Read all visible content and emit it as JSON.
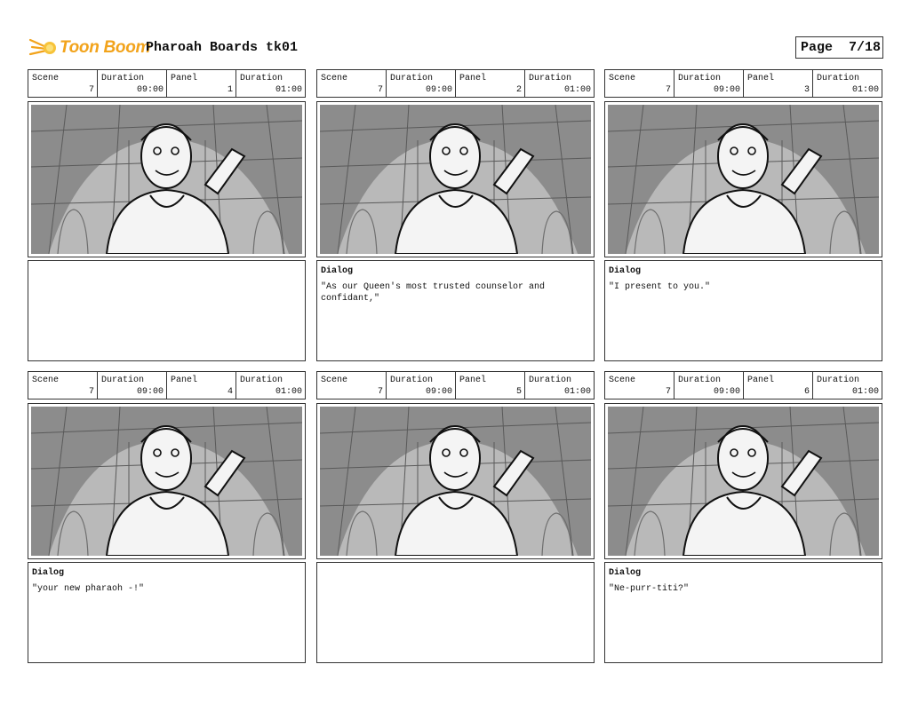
{
  "header": {
    "logo_text": "Toon Boom",
    "project_title": "Pharoah Boards tk01",
    "page_label": "Page",
    "page_number": "7/18"
  },
  "labels": {
    "scene": "Scene",
    "duration": "Duration",
    "panel": "Panel",
    "dialog": "Dialog"
  },
  "panels": [
    {
      "scene": "7",
      "scene_duration": "09:00",
      "panel": "1",
      "panel_duration": "01:00",
      "dialog_label": "",
      "dialog": ""
    },
    {
      "scene": "7",
      "scene_duration": "09:00",
      "panel": "2",
      "panel_duration": "01:00",
      "dialog_label": "Dialog",
      "dialog": "\"As our Queen's most trusted counselor and confidant,\""
    },
    {
      "scene": "7",
      "scene_duration": "09:00",
      "panel": "3",
      "panel_duration": "01:00",
      "dialog_label": "Dialog",
      "dialog": "\"I present to you.\""
    },
    {
      "scene": "7",
      "scene_duration": "09:00",
      "panel": "4",
      "panel_duration": "01:00",
      "dialog_label": "Dialog",
      "dialog": "\"your new pharaoh -!\""
    },
    {
      "scene": "7",
      "scene_duration": "09:00",
      "panel": "5",
      "panel_duration": "01:00",
      "dialog_label": "",
      "dialog": ""
    },
    {
      "scene": "7",
      "scene_duration": "09:00",
      "panel": "6",
      "panel_duration": "01:00",
      "dialog_label": "Dialog",
      "dialog": "\"Ne-purr-titi?\""
    }
  ],
  "colors": {
    "logo": "#f2a31b",
    "sketch_bg": "#8c8c8c",
    "sketch_light": "#b9b9b9",
    "border": "#333333"
  }
}
